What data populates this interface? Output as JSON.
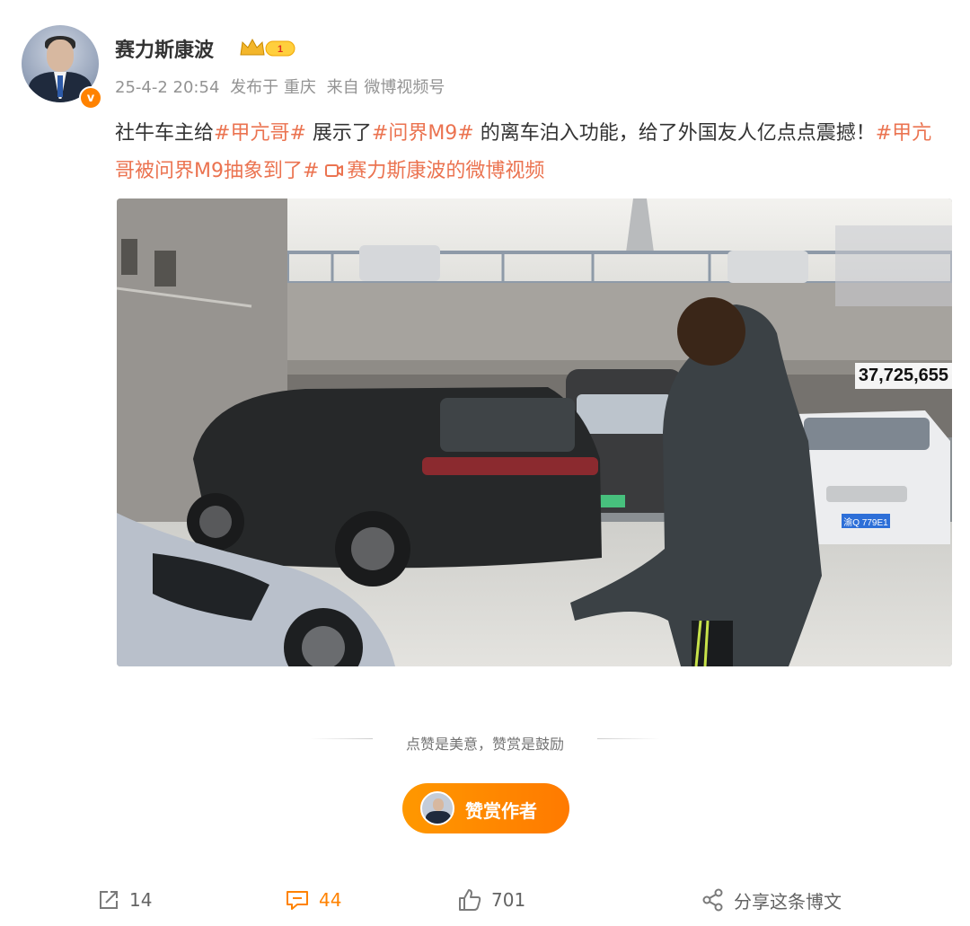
{
  "post": {
    "author": "赛力斯康波",
    "verified_mark": "v",
    "badge_number": "1",
    "date": "25-4-2 20:54",
    "published_at": "发布于 重庆",
    "source": "来自 微博视频号",
    "text_segments": {
      "s1": "社牛车主给",
      "topic1": "#甲亢哥#",
      "s2": " 展示了",
      "topic2": "#问界M9#",
      "s3": " 的离车泊入功能，给了外国友人亿点点震撼！",
      "topic3": "#甲亢哥被问界M9抽象到了#",
      "video_link": "赛力斯康波的微博视频"
    },
    "video": {
      "view_count": "37,725,655",
      "plate_text": "渝Q 779E1"
    }
  },
  "reward": {
    "divider_text": "点赞是美意，赞赏是鼓励",
    "button_label": "赞赏作者"
  },
  "actions": {
    "repost_count": "14",
    "comment_count": "44",
    "like_count": "701",
    "share_label": "分享这条博文"
  },
  "colors": {
    "accent": "#ff8200",
    "topic": "#eb7350",
    "meta": "#939393"
  },
  "icons": [
    "verified-icon",
    "crown-badge-icon",
    "video-link-icon",
    "repost-icon",
    "comment-icon",
    "like-icon",
    "share-icon"
  ]
}
